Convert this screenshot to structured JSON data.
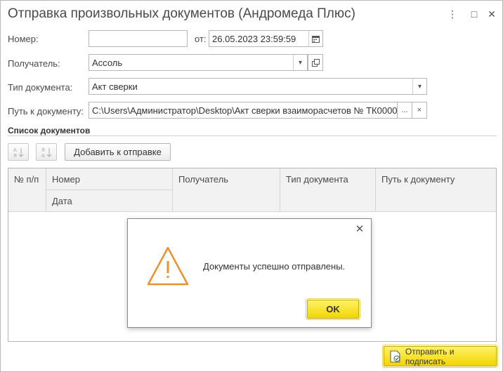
{
  "window": {
    "title": "Отправка произвольных документов (Андромеда Плюс)",
    "menu_icon": "⋮",
    "maximize_icon": "□",
    "close_icon": "✕"
  },
  "form": {
    "number_label": "Номер:",
    "number_value": "",
    "date_label": "от:",
    "date_value": "26.05.2023 23:59:59",
    "recipient_label": "Получатель:",
    "recipient_value": "Ассоль",
    "doc_type_label": "Тип документа:",
    "doc_type_value": "Акт сверки",
    "path_label": "Путь к документу:",
    "path_value": "C:\\Users\\Администратор\\Desktop\\Акт сверки взаиморасчетов № ТК0000",
    "ellipsis": "...",
    "clear": "×"
  },
  "list": {
    "section_title": "Список документов",
    "add_button": "Добавить к отправке",
    "columns": {
      "num": "№ п/п",
      "number": "Номер",
      "date": "Дата",
      "recipient": "Получатель",
      "doc_type": "Тип документа",
      "path": "Путь к документу"
    }
  },
  "dialog": {
    "message": "Документы успешно отправлены.",
    "ok": "OK",
    "close_icon": "✕"
  },
  "footer": {
    "send_sign": "Отправить и подписать"
  }
}
